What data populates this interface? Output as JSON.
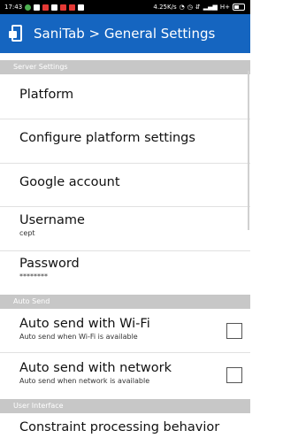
{
  "status_bar": {
    "time": "17:43",
    "network_speed": "4.25K/s",
    "signal_label": "H+"
  },
  "app_bar": {
    "title": "SaniTab > General Settings"
  },
  "sections": {
    "server": "Server Settings",
    "auto_send": "Auto Send",
    "user_interface": "User Interface"
  },
  "items": {
    "platform": {
      "title": "Platform"
    },
    "configure": {
      "title": "Configure platform settings"
    },
    "google": {
      "title": "Google account"
    },
    "username": {
      "title": "Username",
      "value": "cept"
    },
    "password": {
      "title": "Password",
      "value": "********"
    },
    "wifi": {
      "title": "Auto send with Wi-Fi",
      "summary": "Auto send when Wi-Fi is available",
      "checked": false
    },
    "network": {
      "title": "Auto send with network",
      "summary": "Auto send when network is available",
      "checked": false
    },
    "constraint": {
      "title": "Constraint processing behavior"
    }
  }
}
